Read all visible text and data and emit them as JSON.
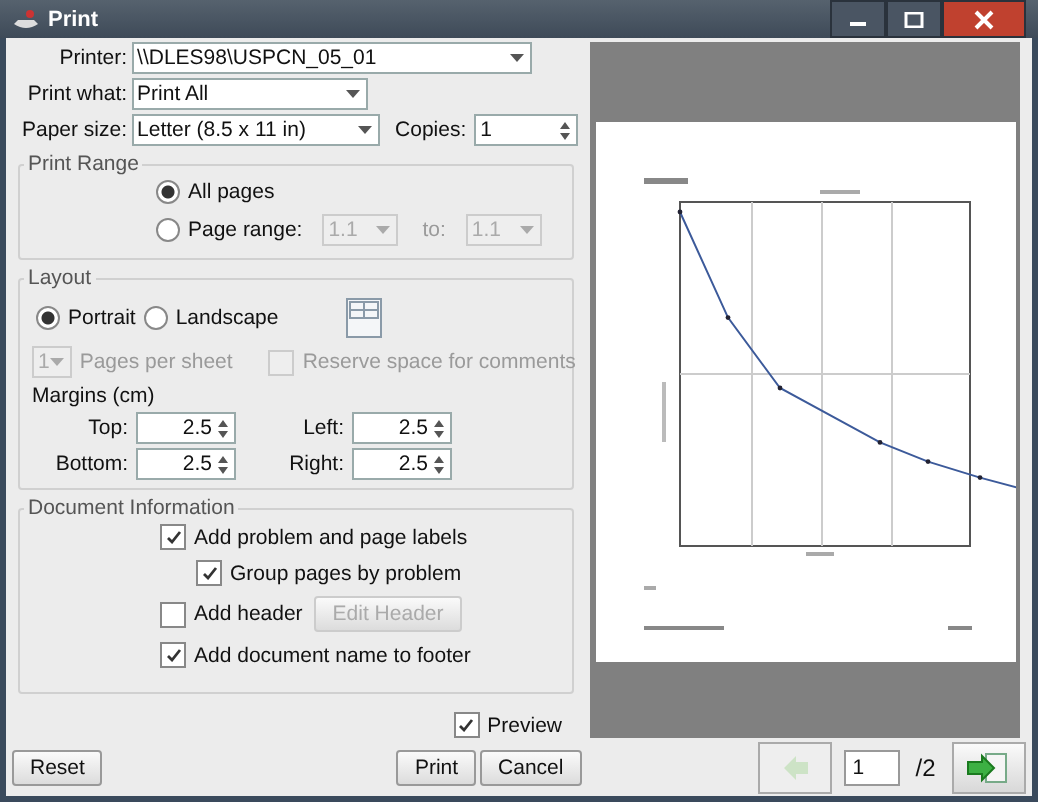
{
  "window": {
    "title": "Print"
  },
  "printer": {
    "label": "Printer:",
    "value": "\\\\DLES98\\USPCN_05_01"
  },
  "print_what": {
    "label": "Print what:",
    "value": "Print All"
  },
  "paper_size": {
    "label": "Paper size:",
    "value": "Letter (8.5 x 11 in)"
  },
  "copies": {
    "label": "Copies:",
    "value": "1"
  },
  "print_range": {
    "title": "Print Range",
    "options": [
      {
        "label": "All pages",
        "selected": true
      },
      {
        "label": "Page range:",
        "selected": false
      }
    ],
    "from": {
      "value": "1.1",
      "disabled": true
    },
    "to_label": "to:",
    "to": {
      "value": "1.1",
      "disabled": true
    }
  },
  "layout": {
    "title": "Layout",
    "orientations": [
      {
        "label": "Portrait",
        "selected": true
      },
      {
        "label": "Landscape",
        "selected": false
      }
    ],
    "pages_per_sheet": {
      "value": "1",
      "label": "Pages per sheet",
      "disabled": true
    },
    "reserve_comments": {
      "label": "Reserve space for comments",
      "checked": false,
      "disabled": true
    },
    "margins_title": "Margins (cm)",
    "margins": [
      {
        "label": "Top:",
        "value": "2.5"
      },
      {
        "label": "Left:",
        "value": "2.5"
      },
      {
        "label": "Bottom:",
        "value": "2.5"
      },
      {
        "label": "Right:",
        "value": "2.5"
      }
    ]
  },
  "document_information": {
    "title": "Document Information",
    "options": [
      {
        "label": "Add problem and page labels",
        "checked": true,
        "children": [
          {
            "label": "Group pages by problem",
            "checked": true
          }
        ]
      },
      {
        "label": "Add header",
        "checked": false,
        "button": {
          "label": "Edit Header",
          "disabled": true
        }
      },
      {
        "label": "Add document name to footer",
        "checked": true
      }
    ]
  },
  "preview": {
    "label": "Preview",
    "checked": true
  },
  "reset_button": "Reset",
  "buttons": [
    "Print",
    "Cancel"
  ],
  "pager": {
    "page": "1",
    "total": "/2"
  }
}
